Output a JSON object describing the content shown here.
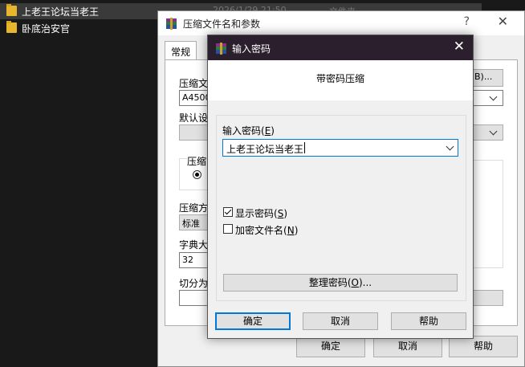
{
  "explorer": {
    "rows": [
      {
        "name": "上老王论坛当老王",
        "date": "2026/1/29 21:50",
        "type": "文件夹"
      },
      {
        "name": "卧底治安官"
      }
    ]
  },
  "back_dialog": {
    "title": "压缩文件名和参数",
    "help_glyph": "?",
    "close_glyph": "✕",
    "tab_general": "常规",
    "archive_name_label": "压缩文",
    "archive_name_value": "A4500",
    "browse_label": "B)...",
    "profile_label": "默认设",
    "format_label": "压缩",
    "method_label": "压缩方",
    "method_value": "标准",
    "dict_label": "字典大",
    "dict_value": "32",
    "split_label": "切分为",
    "ok": "确定",
    "cancel": "取消",
    "help": "帮助"
  },
  "dialog": {
    "title": "输入密码",
    "close_glyph": "✕",
    "header": "带密码压缩",
    "password_label": "输入密码",
    "password_label_hotkey": "E",
    "password_value": "上老王论坛当老王",
    "show_password_label": "显示密码",
    "show_password_hotkey": "S",
    "show_password_checked": true,
    "encrypt_names_label": "加密文件名",
    "encrypt_names_hotkey": "N",
    "encrypt_names_checked": false,
    "organize_label": "整理密码(",
    "organize_hotkey": "O",
    "organize_suffix": ")...",
    "ok": "确定",
    "cancel": "取消",
    "help": "帮助"
  },
  "colors": {
    "title_bar": "#2b1f2e",
    "accent": "#0078d7",
    "dialog_bg": "#f0f0f0"
  }
}
